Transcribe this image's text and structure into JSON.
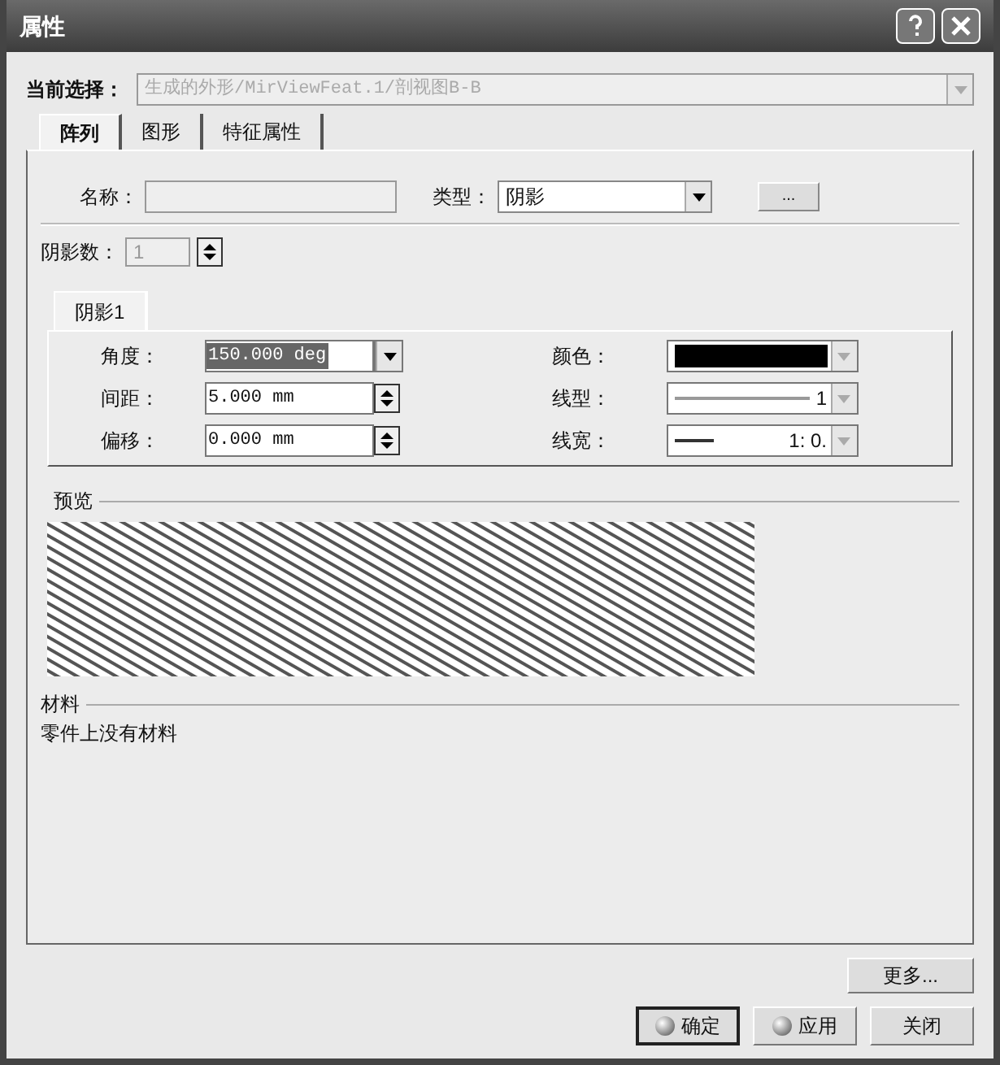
{
  "window": {
    "title": "属性"
  },
  "selection": {
    "label": "当前选择：",
    "value": "生成的外形/MirViewFeat.1/剖视图B-B",
    "disabled": true
  },
  "tabs": [
    {
      "label": "阵列",
      "selected": true
    },
    {
      "label": "图形",
      "selected": false
    },
    {
      "label": "特征属性",
      "selected": false
    }
  ],
  "name_field": {
    "label": "名称："
  },
  "type_field": {
    "label": "类型：",
    "value": "阴影"
  },
  "browse_button": "...",
  "count_field": {
    "label": "阴影数：",
    "value": "1",
    "disabled": true
  },
  "subtabs": [
    {
      "label": "阴影1",
      "selected": true
    }
  ],
  "params": [
    {
      "label": "角度：",
      "value": "150.000 deg",
      "kind": "dropdown",
      "highlighted": true
    },
    {
      "label": "间距：",
      "value": "5.000 mm",
      "kind": "spinner",
      "highlighted": false
    },
    {
      "label": "偏移：",
      "value": "0.000 mm",
      "kind": "spinner",
      "highlighted": false
    }
  ],
  "styles": [
    {
      "label": "颜色：",
      "kind": "color",
      "color": "#000000"
    },
    {
      "label": "线型：",
      "kind": "linetype",
      "value": "1"
    },
    {
      "label": "线宽：",
      "kind": "linewidth",
      "value": "1: 0."
    }
  ],
  "preview": {
    "label": "预览"
  },
  "material": {
    "label": "材料",
    "text": "零件上没有材料"
  },
  "more_button": "更多...",
  "buttons": [
    {
      "label": "确定",
      "kind": "primary"
    },
    {
      "label": "应用",
      "kind": "radio"
    },
    {
      "label": "关闭",
      "kind": "plain"
    }
  ]
}
